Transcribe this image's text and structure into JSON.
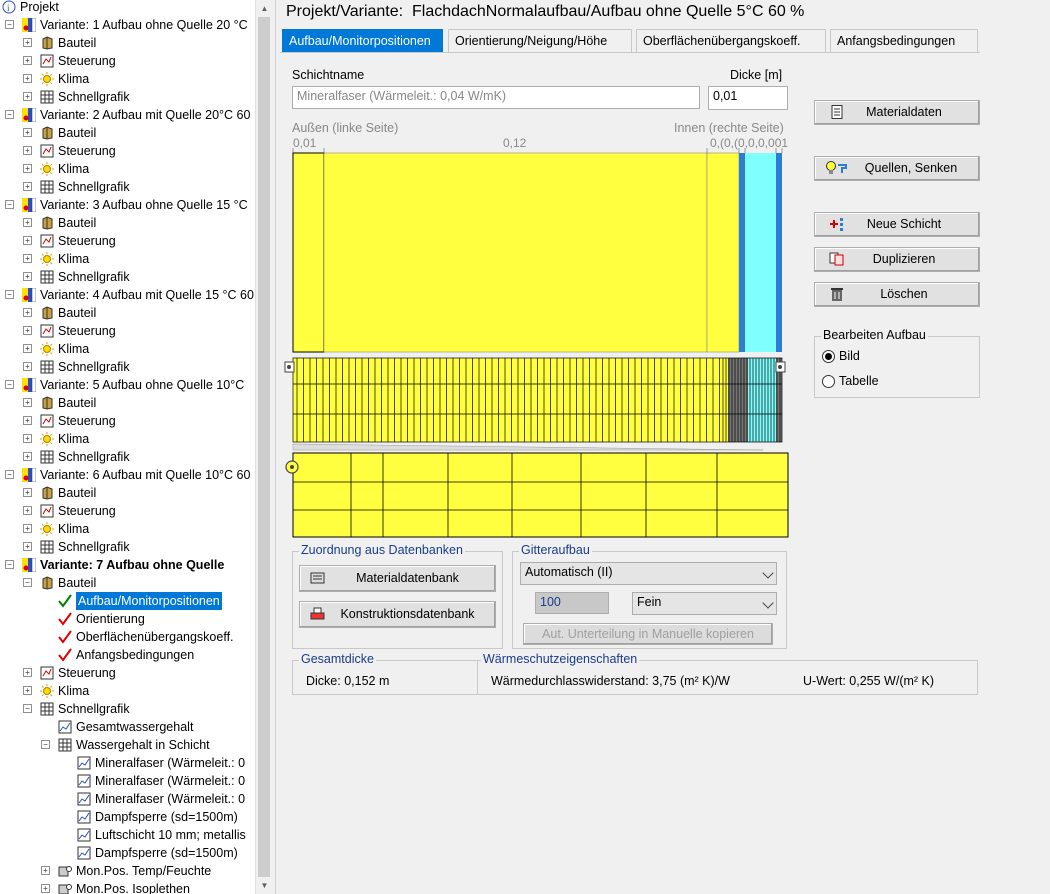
{
  "tree": {
    "root_label": "Projekt",
    "variants": [
      {
        "label": "Variante: 1 Aufbau ohne Quelle 20 °C",
        "children": [
          "Bauteil",
          "Steuerung",
          "Klima",
          "Schnellgrafik"
        ]
      },
      {
        "label": "Variante: 2  Aufbau mit Quelle 20°C 60",
        "children": [
          "Bauteil",
          "Steuerung",
          "Klima",
          "Schnellgrafik"
        ]
      },
      {
        "label": "Variante: 3 Aufbau ohne Quelle 15 °C",
        "children": [
          "Bauteil",
          "Steuerung",
          "Klima",
          "Schnellgrafik"
        ]
      },
      {
        "label": "Variante: 4 Aufbau mit Quelle 15 °C 60",
        "children": [
          "Bauteil",
          "Steuerung",
          "Klima",
          "Schnellgrafik"
        ]
      },
      {
        "label": "Variante: 5 Aufbau ohne Quelle 10°C",
        "children": [
          "Bauteil",
          "Steuerung",
          "Klima",
          "Schnellgrafik"
        ]
      },
      {
        "label": "Variante: 6 Aufbau mit Quelle 10°C 60",
        "children": [
          "Bauteil",
          "Steuerung",
          "Klima",
          "Schnellgrafik"
        ]
      }
    ],
    "active_variant": {
      "label": "Variante: 7 Aufbau ohne Quelle",
      "bauteil": "Bauteil",
      "bauteil_children": [
        "Aufbau/Monitorpositionen",
        "Orientierung",
        "Oberflächenübergangskoeff.",
        "Anfangsbedingungen"
      ],
      "steuerung": "Steuerung",
      "klima": "Klima",
      "schnellgrafik": "Schnellgrafik",
      "gesamtwasser": "Gesamtwassergehalt",
      "wasser_schicht": "Wassergehalt in Schicht",
      "schicht_items": [
        "Mineralfaser (Wärmeleit.: 0",
        "Mineralfaser (Wärmeleit.: 0",
        "Mineralfaser (Wärmeleit.: 0",
        "Dampfsperre (sd=1500m)",
        "Luftschicht 10 mm; metallis",
        "Dampfsperre (sd=1500m)"
      ],
      "mon_temp": "Mon.Pos. Temp/Feuchte",
      "mon_iso": "Mon.Pos. Isoplethen"
    }
  },
  "title": {
    "prefix": "Projekt/Variante:",
    "name": "FlachdachNormalaufbau/Aufbau ohne Quelle 5°C 60 %"
  },
  "tabs": [
    "Aufbau/Monitorpositionen",
    "Orientierung/Neigung/Höhe",
    "Oberflächenübergangskoeff.",
    "Anfangsbedingungen"
  ],
  "layer": {
    "schichtname_label": "Schichtname",
    "schichtname_value": "Mineralfaser (Wärmeleit.: 0,04 W/mK)",
    "dicke_label": "Dicke [m]",
    "dicke_value": "0,01"
  },
  "diagram": {
    "left_label": "Außen (linke Seite)",
    "right_label": "Innen (rechte Seite)",
    "thickness_labels": [
      "0,01",
      "0,12",
      "0,(0,(0,0,0,001"
    ],
    "layer_colors": [
      "#ffff40",
      "#ffff40",
      "#ffff40",
      "#2a7fd4",
      "#80ffff",
      "#2a7fd4"
    ],
    "layer_thicknesses_m": [
      0.01,
      0.12,
      0.012,
      0.001,
      0.01,
      0.001
    ]
  },
  "buttons": {
    "materialdaten": "Materialdaten",
    "quellen": "Quellen, Senken",
    "neue_schicht": "Neue Schicht",
    "duplizieren": "Duplizieren",
    "loeschen": "Löschen"
  },
  "bearbeiten": {
    "title": "Bearbeiten Aufbau",
    "options": [
      "Bild",
      "Tabelle"
    ],
    "selected": "Bild"
  },
  "zuordnung": {
    "title": "Zuordnung aus Datenbanken",
    "materialdatenbank": "Materialdatenbank",
    "konstruktionsdatenbank": "Konstruktionsdatenbank"
  },
  "gitter": {
    "title": "Gitteraufbau",
    "mode": "Automatisch (II)",
    "count": "100",
    "fineness": "Fein",
    "copy_button": "Aut. Unterteilung in Manuelle kopieren"
  },
  "gesamtdicke": {
    "title": "Gesamtdicke",
    "value": "Dicke: 0,152 m"
  },
  "waerme": {
    "title": "Wärmeschutzeigenschaften",
    "widerstand": "Wärmedurchlasswiderstand: 3,75 (m² K)/W",
    "uwert": "U-Wert: 0,255 W/(m² K)"
  },
  "colors": {
    "selection": "#0078d7",
    "layer_yellow": "#ffff40",
    "layer_blue": "#2a7fd4",
    "layer_cyan": "#80ffff",
    "group_title": "#1a3c8c"
  }
}
